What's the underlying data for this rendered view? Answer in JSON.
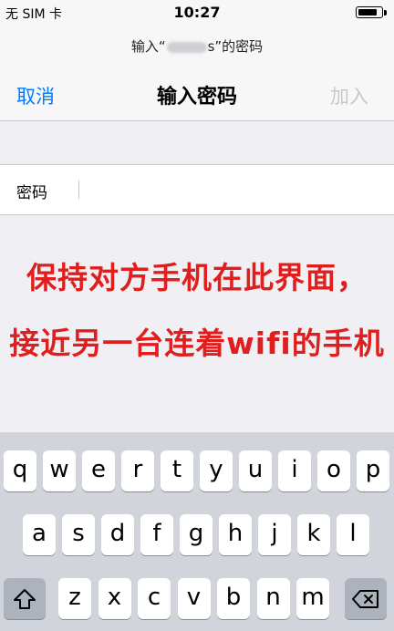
{
  "status": {
    "carrier": "无 SIM 卡",
    "time": "10:27",
    "battery_level": 0.85
  },
  "prompt": {
    "before": "输入“",
    "after": "s”的密码"
  },
  "nav": {
    "cancel": "取消",
    "title": "输入密码",
    "join": "加入"
  },
  "password": {
    "label": "密码",
    "value": ""
  },
  "overlay": {
    "line1": "保持对方手机在此界面，",
    "line2": "接近另一台连着wifi的手机"
  },
  "keyboard": {
    "row1": [
      "q",
      "w",
      "e",
      "r",
      "t",
      "y",
      "u",
      "i",
      "o",
      "p"
    ],
    "row2": [
      "a",
      "s",
      "d",
      "f",
      "g",
      "h",
      "j",
      "k",
      "l"
    ],
    "row3": [
      "z",
      "x",
      "c",
      "v",
      "b",
      "n",
      "m"
    ],
    "shift_icon": "shift-arrow-icon",
    "backspace_icon": "backspace-icon"
  },
  "colors": {
    "accent": "#007aff",
    "overlay_text": "#e01e1e",
    "disabled": "#c7c7cc",
    "keyboard_bg": "#d1d5db"
  }
}
